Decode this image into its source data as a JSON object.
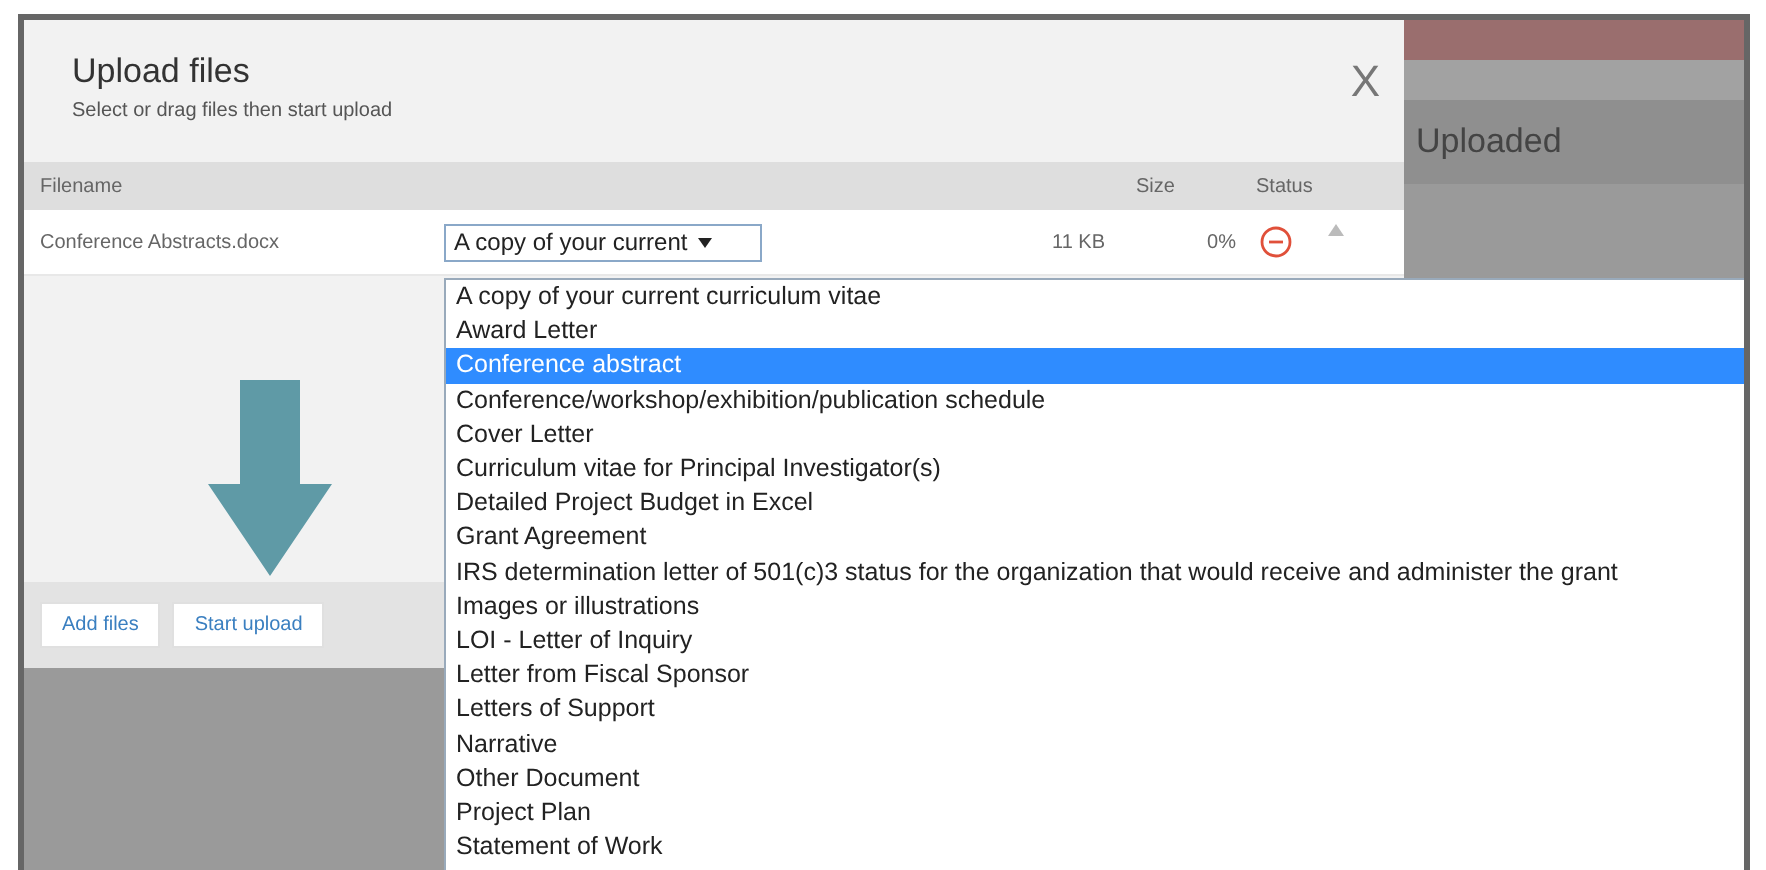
{
  "background": {
    "panel_heading": "Uploaded"
  },
  "dialog": {
    "title": "Upload files",
    "subtitle": "Select or drag files then start upload",
    "close": "X",
    "table": {
      "columns": [
        "Filename",
        "Size",
        "Status"
      ],
      "rows": [
        {
          "filename": "Conference Abstracts.docx",
          "type_select": "A copy of your current",
          "size": "11 KB",
          "status": "0%"
        }
      ]
    },
    "buttons": [
      "Add files",
      "Start upload"
    ]
  },
  "dropdown": {
    "options": [
      {
        "label": "A copy of your current curriculum vitae",
        "selected": false
      },
      {
        "label": "Award Letter",
        "selected": false
      },
      {
        "label": "Conference abstract",
        "selected": true
      },
      {
        "label": "Conference/workshop/exhibition/publication schedule",
        "selected": false
      },
      {
        "label": "Cover Letter",
        "selected": false
      },
      {
        "label": "Curriculum vitae for Principal Investigator(s)",
        "selected": false
      },
      {
        "label": "Detailed Project Budget in Excel",
        "selected": false
      },
      {
        "label": "Grant Agreement",
        "selected": false
      },
      {
        "label": "IRS determination letter of 501(c)3 status for the organization that would receive and administer the grant",
        "selected": false
      },
      {
        "label": "Images or illustrations",
        "selected": false
      },
      {
        "label": "LOI - Letter of Inquiry",
        "selected": false
      },
      {
        "label": "Letter from Fiscal Sponsor",
        "selected": false
      },
      {
        "label": "Letters of Support",
        "selected": false
      },
      {
        "label": "Narrative",
        "selected": false
      },
      {
        "label": "Other Document",
        "selected": false
      },
      {
        "label": "Project Plan",
        "selected": false
      },
      {
        "label": "Statement of Work",
        "selected": false
      }
    ]
  }
}
